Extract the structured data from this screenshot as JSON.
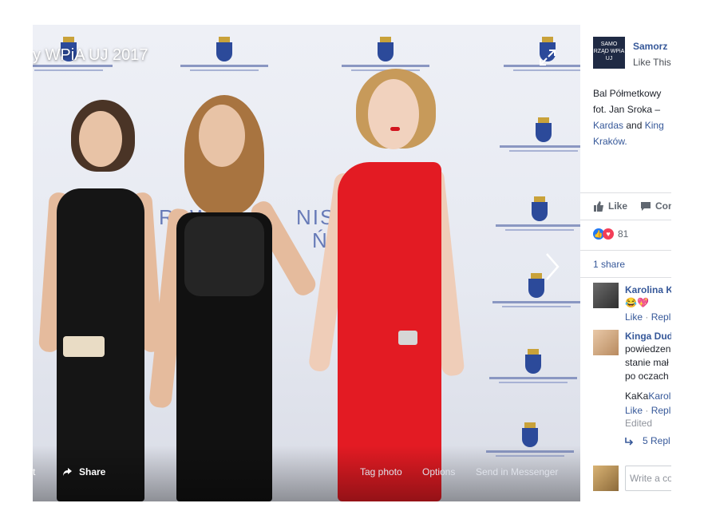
{
  "photo": {
    "album_title": "y WPiA UJ 2017",
    "backdrop_text_1": "RAW",
    "backdrop_text_2": "NIST",
    "backdrop_text_3": "ŃSK",
    "actions": {
      "left_fragment": "t",
      "share": "Share",
      "tag_photo": "Tag photo",
      "options": "Options",
      "send_in_messenger": "Send in Messenger"
    }
  },
  "sidebar": {
    "page_name": "Samorz",
    "page_logo_text": "SAMO RZĄD WPiA UJ",
    "like_this": "Like This",
    "caption": {
      "line1": "Bal Półmetkowy",
      "line2": "fot. Jan Sroka –",
      "line3_link1": "Kardas",
      "line3_and": " and ",
      "line3_link2": "King",
      "line4": "Kraków."
    },
    "like_label": "Like",
    "comment_label": "Com",
    "reaction_count": "81",
    "shares": "1 share",
    "comments": [
      {
        "name": "Karolina K",
        "text": "😂💖",
        "meta_like": "Like",
        "meta_reply": "Repl"
      },
      {
        "name": "Kinga Duda",
        "text_lines": [
          "powiedzen",
          "stanie mał",
          "po oczach"
        ]
      },
      {
        "text_prefix": "KaKa",
        "text_link": "Karol",
        "meta_like": "Like",
        "meta_reply": "Repl",
        "edited": "Edited"
      }
    ],
    "replies": "5 Repl",
    "write_placeholder": "Write a co"
  },
  "colors": {
    "link": "#365899",
    "like_blue": "#2078f4",
    "love_red": "#f33e58",
    "dress_red": "#e31b23"
  }
}
